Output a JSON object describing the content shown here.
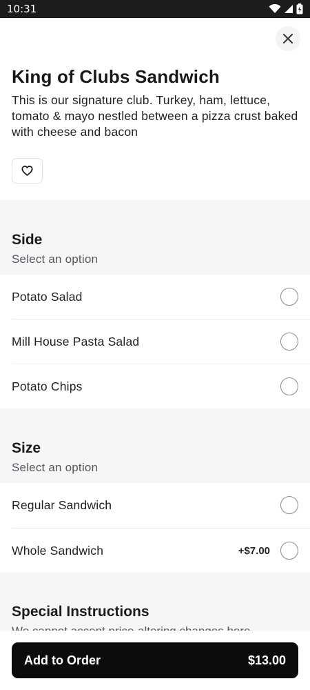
{
  "status_bar": {
    "time": "10:31",
    "icons": [
      "wifi-icon",
      "signal-icon",
      "battery-icon"
    ]
  },
  "item": {
    "title": "King of Clubs Sandwich",
    "description": "This is our signature club. Turkey, ham, lettuce, tomato & mayo nestled between a pizza crust baked with cheese and bacon"
  },
  "sections": {
    "side": {
      "title": "Side",
      "subtitle": "Select an option",
      "options": [
        {
          "label": "Potato Salad",
          "price": ""
        },
        {
          "label": "Mill House Pasta Salad",
          "price": ""
        },
        {
          "label": "Potato Chips",
          "price": ""
        }
      ]
    },
    "size": {
      "title": "Size",
      "subtitle": "Select an option",
      "options": [
        {
          "label": "Regular Sandwich",
          "price": ""
        },
        {
          "label": "Whole Sandwich",
          "price": "+$7.00"
        }
      ]
    },
    "special": {
      "title": "Special Instructions",
      "hint": "We cannot accept price-altering changes here"
    }
  },
  "order_button": {
    "label": "Add to Order",
    "price": "$13.00"
  },
  "colors": {
    "section_bg": "#f6f5f8",
    "button_bg": "#0c0c0c",
    "status_bar_bg": "#1c1c1c"
  }
}
